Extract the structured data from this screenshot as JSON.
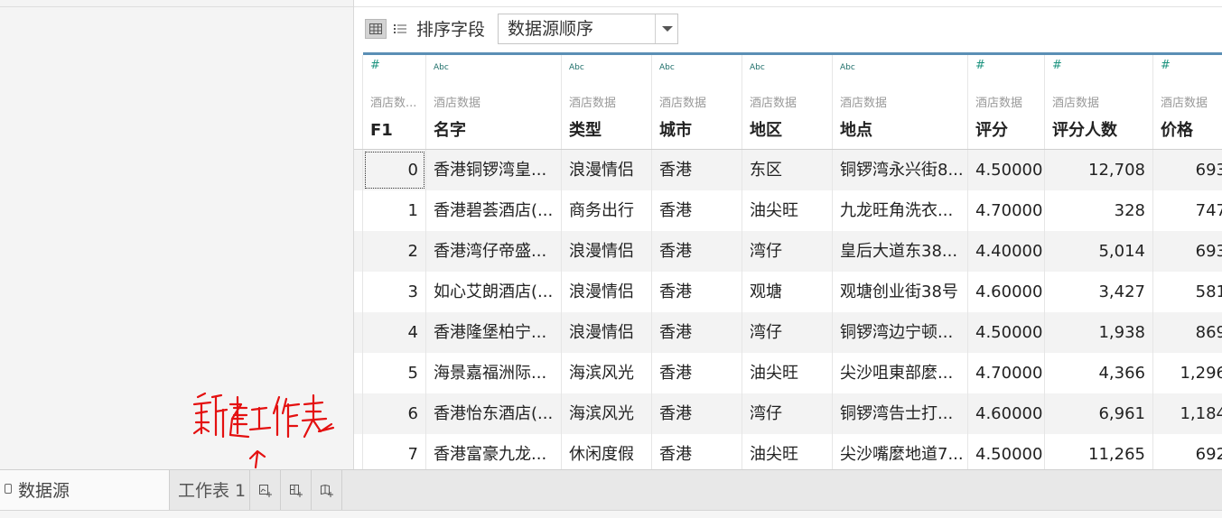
{
  "toolbar": {
    "sort_label": "排序字段",
    "sort_value": "数据源顺序"
  },
  "table": {
    "columns": [
      {
        "type": "#",
        "source": "酒店数...",
        "name": "F1"
      },
      {
        "type": "Abc",
        "source": "酒店数据",
        "name": "名字"
      },
      {
        "type": "Abc",
        "source": "酒店数据",
        "name": "类型"
      },
      {
        "type": "Abc",
        "source": "酒店数据",
        "name": "城市"
      },
      {
        "type": "Abc",
        "source": "酒店数据",
        "name": "地区"
      },
      {
        "type": "Abc",
        "source": "酒店数据",
        "name": "地点"
      },
      {
        "type": "#",
        "source": "酒店数据",
        "name": "评分"
      },
      {
        "type": "#",
        "source": "酒店数据",
        "name": "评分人数"
      },
      {
        "type": "#",
        "source": "酒店数据",
        "name": "价格"
      }
    ],
    "rows": [
      [
        "0",
        "香港铜锣湾皇...",
        "浪漫情侣",
        "香港",
        "东区",
        "铜锣湾永兴街8...",
        "4.50000",
        "12,708",
        "693"
      ],
      [
        "1",
        "香港碧荟酒店(...",
        "商务出行",
        "香港",
        "油尖旺",
        "九龙旺角洗衣...",
        "4.70000",
        "328",
        "747"
      ],
      [
        "2",
        "香港湾仔帝盛...",
        "浪漫情侣",
        "香港",
        "湾仔",
        "皇后大道东38...",
        "4.40000",
        "5,014",
        "693"
      ],
      [
        "3",
        "如心艾朗酒店(...",
        "浪漫情侣",
        "香港",
        "观塘",
        "观塘创业街38号",
        "4.60000",
        "3,427",
        "581"
      ],
      [
        "4",
        "香港隆堡柏宁...",
        "浪漫情侣",
        "香港",
        "湾仔",
        "铜锣湾边宁顿...",
        "4.50000",
        "1,938",
        "869"
      ],
      [
        "5",
        "海景嘉福洲际...",
        "海滨风光",
        "香港",
        "油尖旺",
        "尖沙咀東部麼...",
        "4.70000",
        "4,366",
        "1,296"
      ],
      [
        "6",
        "香港怡东酒店(...",
        "海滨风光",
        "香港",
        "湾仔",
        "铜锣湾告士打...",
        "4.60000",
        "6,961",
        "1,184"
      ],
      [
        "7",
        "香港富豪九龙...",
        "休闲度假",
        "香港",
        "油尖旺",
        "尖沙嘴麼地道7...",
        "4.50000",
        "11,265",
        "692"
      ]
    ]
  },
  "tabs": {
    "datasource_label": "数据源",
    "sheet1_label": "工作表 1"
  },
  "annotation": {
    "handwritten_text": "新建工作表"
  },
  "colors": {
    "accent": "#5b8fb5",
    "annotation": "#e41010"
  },
  "icons": {
    "grid_view": "grid-view-icon",
    "list_view": "list-view-icon",
    "datasource": "datasource-icon",
    "new_worksheet": "new-worksheet-icon",
    "new_dashboard": "new-dashboard-icon",
    "new_story": "new-story-icon"
  }
}
